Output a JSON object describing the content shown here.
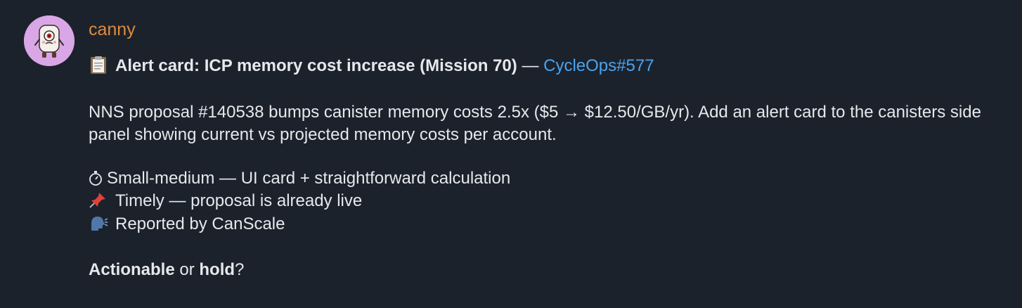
{
  "message": {
    "author": "canny",
    "author_color": "#e08a3c",
    "title": {
      "icon": "clipboard-icon",
      "bold_text": "Alert card: ICP memory cost increase (Mission 70)",
      "separator": " — ",
      "link_text": "CycleOps#577",
      "link_color": "#4aa3ef"
    },
    "body": "NNS proposal #140538 bumps canister memory costs 2.5x ($5 → $12.50/GB/yr). Add an alert card to the canisters side panel showing current vs projected memory costs per account.",
    "items": [
      {
        "icon": "stopwatch-icon",
        "text": "Small-medium — UI card + straightforward calculation"
      },
      {
        "icon": "pushpin-icon",
        "text": "Timely — proposal is already live"
      },
      {
        "icon": "speaking-head-icon",
        "text": "Reported by CanScale"
      }
    ],
    "question": {
      "option_a": "Actionable",
      "middle": " or ",
      "option_b": "hold",
      "end": "?"
    }
  }
}
